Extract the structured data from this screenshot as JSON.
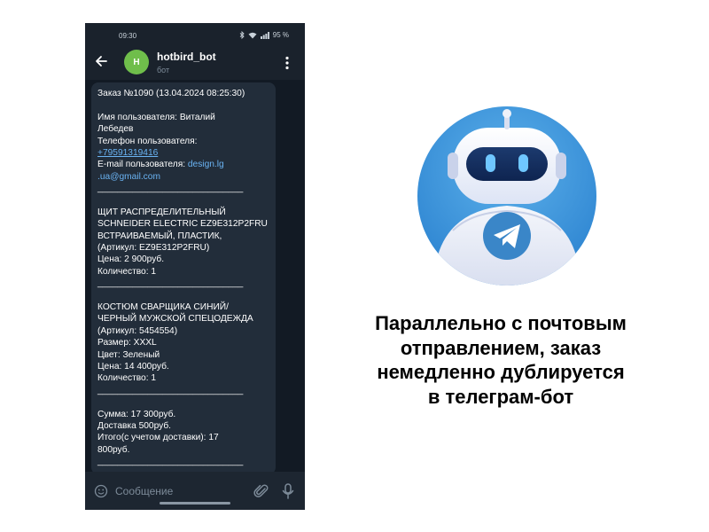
{
  "status_bar": {
    "time": "09:30",
    "battery": "95 %"
  },
  "chat_header": {
    "avatar_letter": "H",
    "bot_name": "hotbird_bot",
    "bot_status": "бот"
  },
  "message": {
    "order_title": "Заказ №1090 (13.04.2024 08:25:30)",
    "user_name_line1": "Имя пользователя:   Виталий",
    "user_name_line2": "Лебедев",
    "phone_label": "Телефон пользователя:",
    "phone_value": "+79591319416",
    "email_label": "E-mail пользователя: ",
    "email_value_part1": "design.lg",
    "email_value_part2": ".ua@gmail.com",
    "divider": "_____________________________",
    "item1": {
      "line1": "ЩИТ РАСПРЕДЕЛИТЕЛЬНЫЙ",
      "line2": "SCHNEIDER ELECTRIC EZ9E312P2FRU",
      "line3": "ВСТРАИВАЕМЫЙ, ПЛАСТИК,",
      "article": "(Артикул: EZ9E312P2FRU)",
      "price": "Цена: 2 900руб.",
      "quantity": "Количество: 1"
    },
    "item2": {
      "line1": "КОСТЮМ СВАРЩИКА СИНИЙ/",
      "line2": "ЧЕРНЫЙ МУЖСКОЙ СПЕЦОДЕЖДА",
      "article": "(Артикул: 5454554)",
      "size": "Размер: XXXL",
      "color": "Цвет: Зеленый",
      "price": "Цена: 14 400руб.",
      "quantity": "Количество: 1"
    },
    "sum": "Сумма:  17 300руб.",
    "delivery": "Доставка 500руб.",
    "total_line1": "Итого(с учетом доставки): 17",
    "total_line2": "800руб."
  },
  "input_bar": {
    "placeholder": "Сообщение"
  },
  "caption": {
    "line1": "Параллельно с почтовым",
    "line2": "отправлением, заказ",
    "line3": "немедленно дублируется",
    "line4": "в телеграм-бот"
  },
  "colors": {
    "phone_background": "#1a222c",
    "bubble": "#222d3a",
    "link": "#6ab3f3",
    "avatar": "#6fbe4b",
    "robot_circle": "#3b8fd6",
    "telegram_badge": "#3a86c8"
  },
  "icons": [
    "back-arrow-icon",
    "more-vertical-icon",
    "emoji-icon",
    "attachment-icon",
    "microphone-icon",
    "telegram-plane-icon",
    "bluetooth-icon",
    "wifi-icon",
    "signal-icon"
  ]
}
